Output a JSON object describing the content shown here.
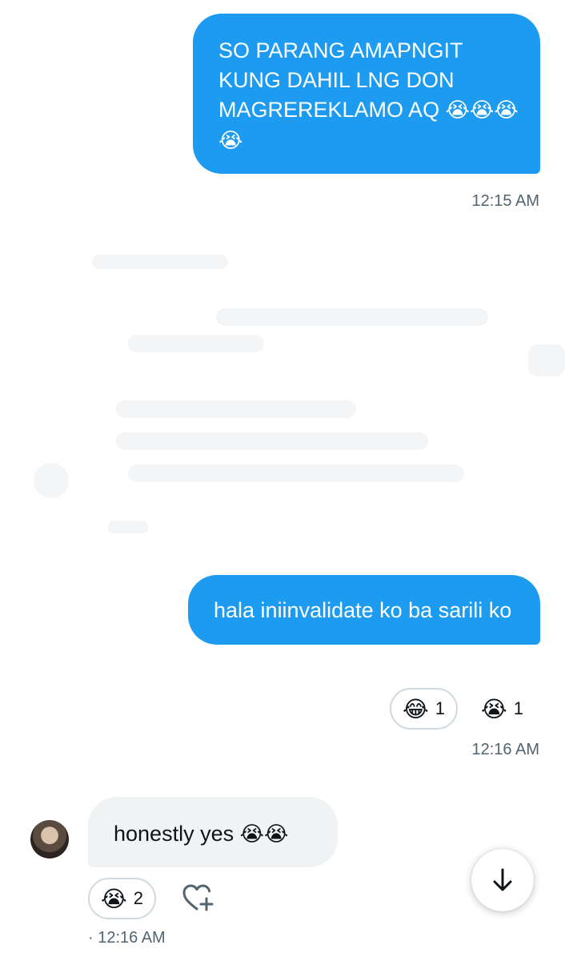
{
  "messages": [
    {
      "direction": "outgoing",
      "text": "SO PARANG AMAPNGIT KUNG DAHIL LNG DON MAGREREKLAMO AQ",
      "emojis": "😭😭😭😭",
      "time": "12:15 AM"
    },
    {
      "direction": "outgoing",
      "text": "hala iniinvalidate ko ba sarili ko",
      "time": "12:16 AM",
      "reactions": [
        {
          "emoji": "😂",
          "count": "1",
          "icon": "laughing-emoji"
        },
        {
          "emoji": "😭",
          "count": "1",
          "icon": "crying-emoji"
        }
      ]
    },
    {
      "direction": "incoming",
      "text": "honestly yes",
      "emojis": "😭😭",
      "time": "· 12:16 AM",
      "reactions": [
        {
          "emoji": "😭",
          "count": "2",
          "icon": "crying-emoji"
        }
      ]
    }
  ],
  "colors": {
    "outgoing_bubble": "#1d9bf0",
    "incoming_bubble": "#eff3f4",
    "timestamp": "#536471"
  },
  "icons": {
    "add_reaction": "heart-plus-icon",
    "scroll_down": "arrow-down-icon",
    "avatar": "user-avatar"
  }
}
